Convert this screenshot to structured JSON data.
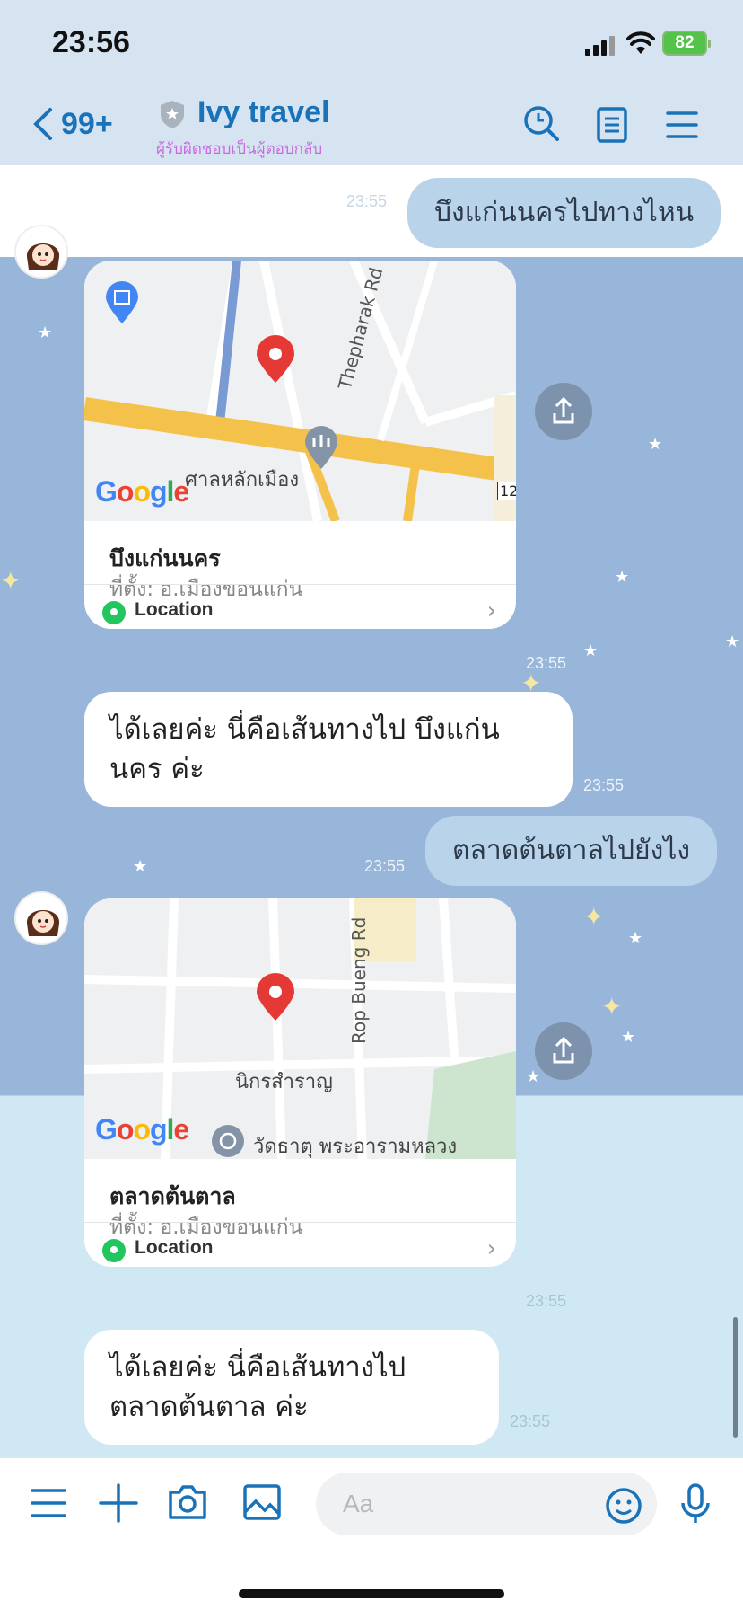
{
  "status_bar": {
    "time": "23:56",
    "battery": "82"
  },
  "header": {
    "back_count": "99+",
    "title": "Ivy travel",
    "subtitle": "ผู้รับผิดชอบเป็นผู้ตอบกลับ",
    "icons": [
      "search-icon",
      "notes-icon",
      "menu-icon"
    ]
  },
  "messages": [
    {
      "type": "outgoing",
      "text": "บึงแก่นนครไปทางไหน",
      "time": "23:55"
    },
    {
      "type": "location",
      "name": "บึงแก่นนคร",
      "address": "ที่ตั้ง: อ.เมืองขอนแก่น",
      "label": "Location",
      "time": "23:55",
      "map_labels": [
        "Thepharak Rd",
        "ศาลหลักเมือง",
        "Google",
        "12"
      ]
    },
    {
      "type": "incoming",
      "text": "ได้เลยค่ะ นี่คือเส้นทางไป บึงแก่นนคร ค่ะ",
      "time": "23:55"
    },
    {
      "type": "outgoing",
      "text": "ตลาดต้นตาลไปยังไง",
      "time": "23:55"
    },
    {
      "type": "location",
      "name": "ตลาดต้นตาล",
      "address": "ที่ตั้ง: อ.เมืองขอนแก่น",
      "label": "Location",
      "time": "23:55",
      "map_labels": [
        "Rop Bueng Rd",
        "นิกรสำราญ",
        "วัดธาตุ พระอารามหลวง",
        "Google"
      ]
    },
    {
      "type": "incoming",
      "text": "ได้เลยค่ะ นี่คือเส้นทางไป ตลาดต้นตาล ค่ะ",
      "time": "23:55"
    }
  ],
  "input_bar": {
    "placeholder": "Aa"
  },
  "colors": {
    "accent": "#1a73b8",
    "chat_bg": "#98b5da",
    "bubble_out": "#b9d3ea",
    "location_green": "#22c55e"
  }
}
